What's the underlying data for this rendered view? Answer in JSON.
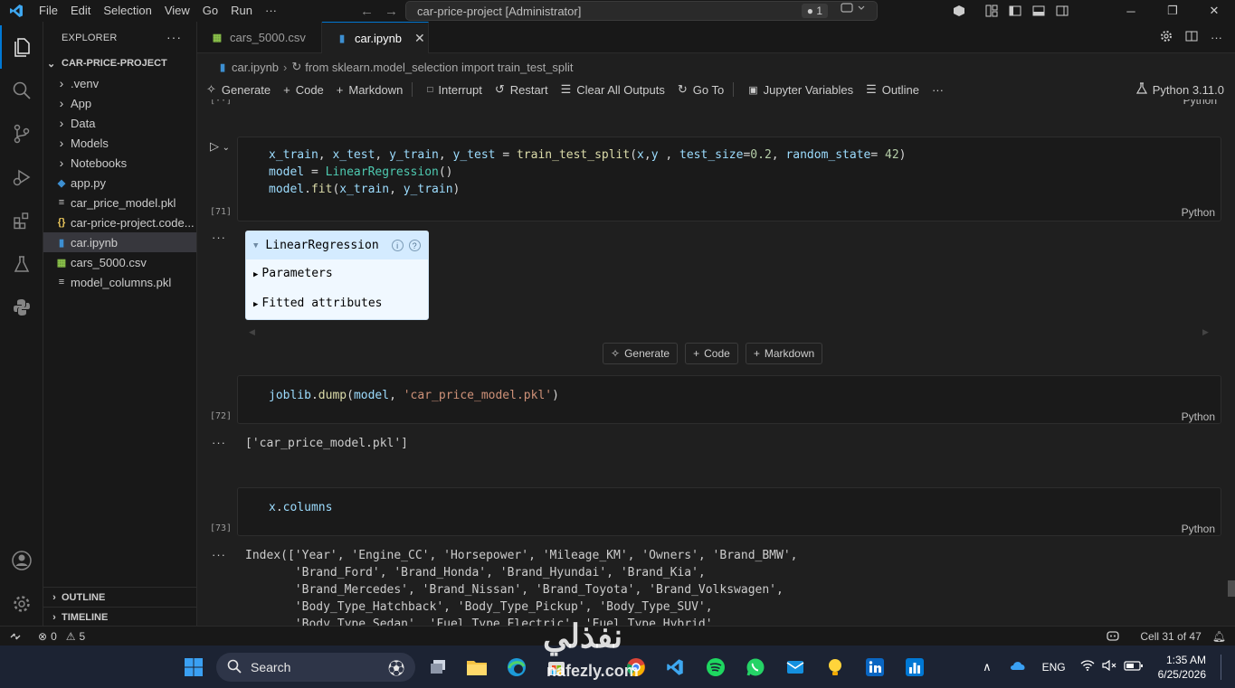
{
  "menu": [
    "File",
    "Edit",
    "Selection",
    "View",
    "Go",
    "Run",
    "···"
  ],
  "command_center": {
    "text": "car-price-project [Administrator]",
    "badge": "● 1"
  },
  "explorer": {
    "title": "EXPLORER",
    "root": "CAR-PRICE-PROJECT",
    "items": [
      {
        "label": ".venv",
        "kind": "folder"
      },
      {
        "label": "App",
        "kind": "folder"
      },
      {
        "label": "Data",
        "kind": "folder"
      },
      {
        "label": "Models",
        "kind": "folder"
      },
      {
        "label": "Notebooks",
        "kind": "folder"
      },
      {
        "label": "app.py",
        "kind": "python"
      },
      {
        "label": "car_price_model.pkl",
        "kind": "text"
      },
      {
        "label": "car-price-project.code...",
        "kind": "json"
      },
      {
        "label": "car.ipynb",
        "kind": "notebook"
      },
      {
        "label": "cars_5000.csv",
        "kind": "csv"
      },
      {
        "label": "model_columns.pkl",
        "kind": "text"
      }
    ],
    "outline": "OUTLINE",
    "timeline": "TIMELINE"
  },
  "tabs": [
    {
      "label": "cars_5000.csv",
      "active": false
    },
    {
      "label": "car.ipynb",
      "active": true
    }
  ],
  "breadcrumb": {
    "file": "car.ipynb",
    "symbol": "from sklearn.model_selection import train_test_split"
  },
  "toolbar": {
    "generate": "Generate",
    "code": "Code",
    "markdown": "Markdown",
    "interrupt": "Interrupt",
    "restart": "Restart",
    "clear": "Clear All Outputs",
    "goto": "Go To",
    "variables": "Jupyter Variables",
    "outline": "Outline",
    "kernel": "Python 3.11.0"
  },
  "cells": {
    "c71": {
      "count": "[71]",
      "lang": "Python"
    },
    "c72": {
      "count": "[72]",
      "lang": "Python",
      "output": "['car_price_model.pkl']"
    },
    "c73": {
      "count": "[73]",
      "lang": "Python",
      "output": [
        "Index(['Year', 'Engine_CC', 'Horsepower', 'Mileage_KM', 'Owners', 'Brand_BMW',",
        "       'Brand_Ford', 'Brand_Honda', 'Brand_Hyundai', 'Brand_Kia',",
        "       'Brand_Mercedes', 'Brand_Nissan', 'Brand_Toyota', 'Brand_Volkswagen',",
        "       'Body_Type_Hatchback', 'Body_Type_Pickup', 'Body_Type_SUV',",
        "       'Body_Type_Sedan', 'Fuel_Type_Electric', 'Fuel_Type_Hybrid',"
      ]
    },
    "prev_lang": "Python"
  },
  "estimator": {
    "title": "LinearRegression",
    "params": "Parameters",
    "fitted": "Fitted attributes",
    "info": "i",
    "help": "?"
  },
  "insert": {
    "generate": "Generate",
    "code": "Code",
    "markdown": "Markdown"
  },
  "status": {
    "errors": "0",
    "warnings": "5",
    "cell": "Cell 31 of 47"
  },
  "taskbar": {
    "search": "Search",
    "lang": "ENG",
    "time": "1:35 AM",
    "date": "6/25/2026"
  },
  "watermark": {
    "arabic": "نفذلي",
    "latin": "nafezly.com"
  },
  "colors": {
    "accent": "#0078d4",
    "editor_bg": "#1f1f1f",
    "sidebar_bg": "#181818",
    "taskbar_bg": "#1c2333"
  }
}
